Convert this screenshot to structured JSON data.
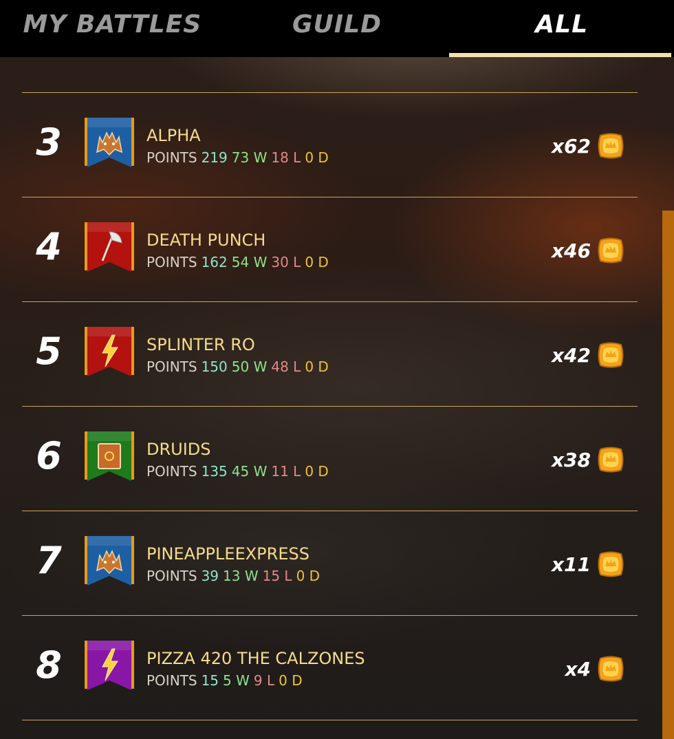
{
  "tabs": [
    {
      "label": "MY BATTLES",
      "active": false
    },
    {
      "label": "GUILD",
      "active": false
    },
    {
      "label": "ALL",
      "active": true
    }
  ],
  "stat_labels": {
    "points": "POINTS",
    "win": "W",
    "loss": "L",
    "draw": "D"
  },
  "colors": {
    "name": "#f6dc8a",
    "points": "#8de6ca",
    "wins": "#8fe38c",
    "losses": "#e5888a",
    "draws": "#f2c230",
    "divider": "#c9a659",
    "active_tab": "#f3e2ae"
  },
  "rows": [
    {
      "rank": "3",
      "name": "ALPHA",
      "points": "219",
      "wins": "73",
      "losses": "18",
      "draws": "0",
      "reward": "x62",
      "icon": "wolf-icon",
      "banner_color": "#1e5fa3"
    },
    {
      "rank": "4",
      "name": "DEATH PUNCH",
      "points": "162",
      "wins": "54",
      "losses": "30",
      "draws": "0",
      "reward": "x46",
      "icon": "axe-icon",
      "banner_color": "#b3120e"
    },
    {
      "rank": "5",
      "name": "SPLINTER RO",
      "points": "150",
      "wins": "50",
      "losses": "48",
      "draws": "0",
      "reward": "x42",
      "icon": "lightning-icon",
      "banner_color": "#b3120e"
    },
    {
      "rank": "6",
      "name": "DRUIDS",
      "points": "135",
      "wins": "45",
      "losses": "11",
      "draws": "0",
      "reward": "x38",
      "icon": "book-icon",
      "banner_color": "#1f7a1c"
    },
    {
      "rank": "7",
      "name": "PINEAPPLEEXPRESS",
      "points": "39",
      "wins": "13",
      "losses": "15",
      "draws": "0",
      "reward": "x11",
      "icon": "wolf-icon",
      "banner_color": "#1e5fa3"
    },
    {
      "rank": "8",
      "name": "PIZZA 420 THE CALZONES",
      "points": "15",
      "wins": "5",
      "losses": "9",
      "draws": "0",
      "reward": "x4",
      "icon": "lightning-icon",
      "banner_color": "#8a16a6"
    }
  ]
}
